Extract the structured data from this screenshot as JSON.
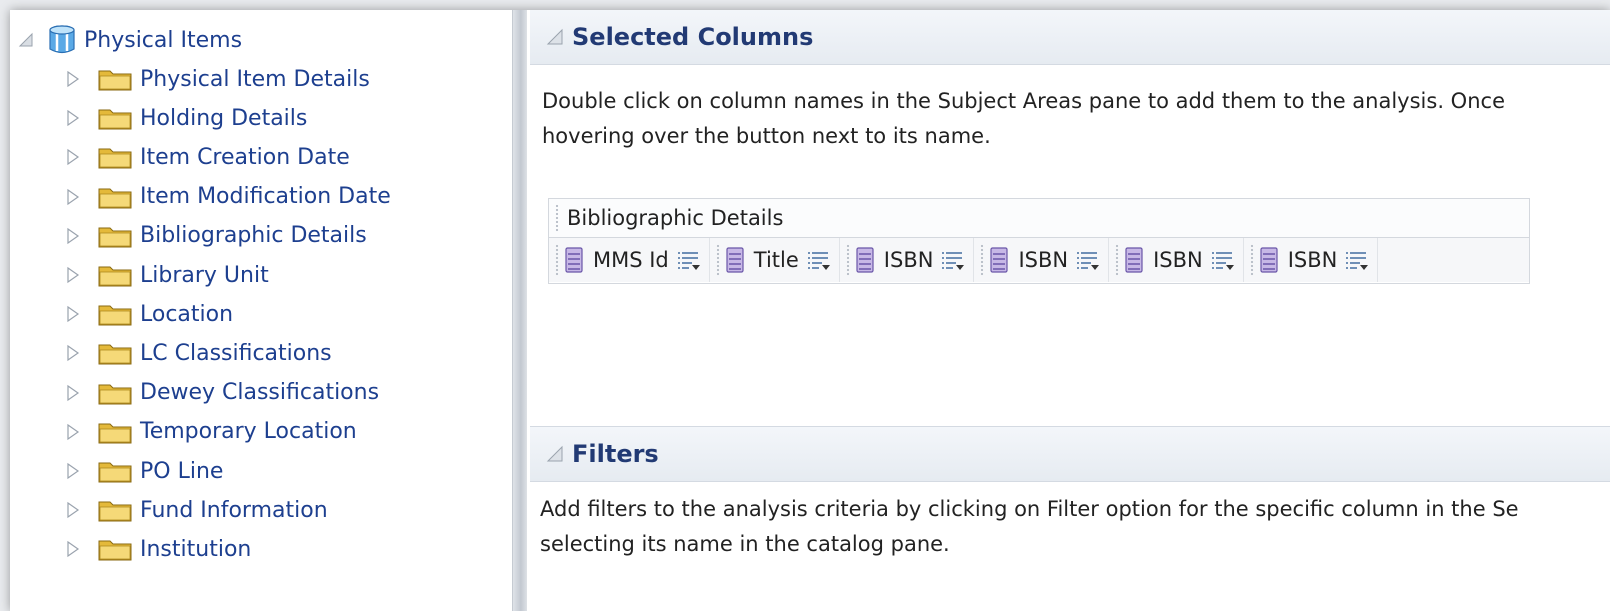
{
  "tree": {
    "root": {
      "label": "Physical Items",
      "icon": "subject-area-cube-icon"
    },
    "children": [
      {
        "label": "Physical Item Details",
        "icon": "folder-icon"
      },
      {
        "label": "Holding Details",
        "icon": "folder-icon"
      },
      {
        "label": "Item Creation Date",
        "icon": "folder-icon"
      },
      {
        "label": "Item Modification Date",
        "icon": "folder-icon"
      },
      {
        "label": "Bibliographic Details",
        "icon": "folder-icon"
      },
      {
        "label": "Library Unit",
        "icon": "folder-icon"
      },
      {
        "label": "Location",
        "icon": "folder-icon"
      },
      {
        "label": "LC Classifications",
        "icon": "folder-icon"
      },
      {
        "label": "Dewey Classifications",
        "icon": "folder-icon"
      },
      {
        "label": "Temporary Location",
        "icon": "folder-icon"
      },
      {
        "label": "PO Line",
        "icon": "folder-icon"
      },
      {
        "label": "Fund Information",
        "icon": "folder-icon"
      },
      {
        "label": "Institution",
        "icon": "folder-icon"
      }
    ]
  },
  "selected_columns": {
    "title": "Selected Columns",
    "instructions": [
      "Double click on column names in the Subject Areas pane to add them to the analysis. Once",
      "hovering over the button next to its name."
    ],
    "folder": "Bibliographic Details",
    "columns": [
      "MMS Id",
      "Title",
      "ISBN",
      "ISBN",
      "ISBN",
      "ISBN"
    ]
  },
  "filters": {
    "title": "Filters",
    "instructions": [
      "Add filters to the analysis criteria by clicking on Filter option for the specific column in the Se",
      "selecting its name in the catalog pane."
    ]
  },
  "colors": {
    "tree_text": "#1d3f8f",
    "header_title": "#223a74",
    "folder_yellow": "#e9c44a"
  }
}
